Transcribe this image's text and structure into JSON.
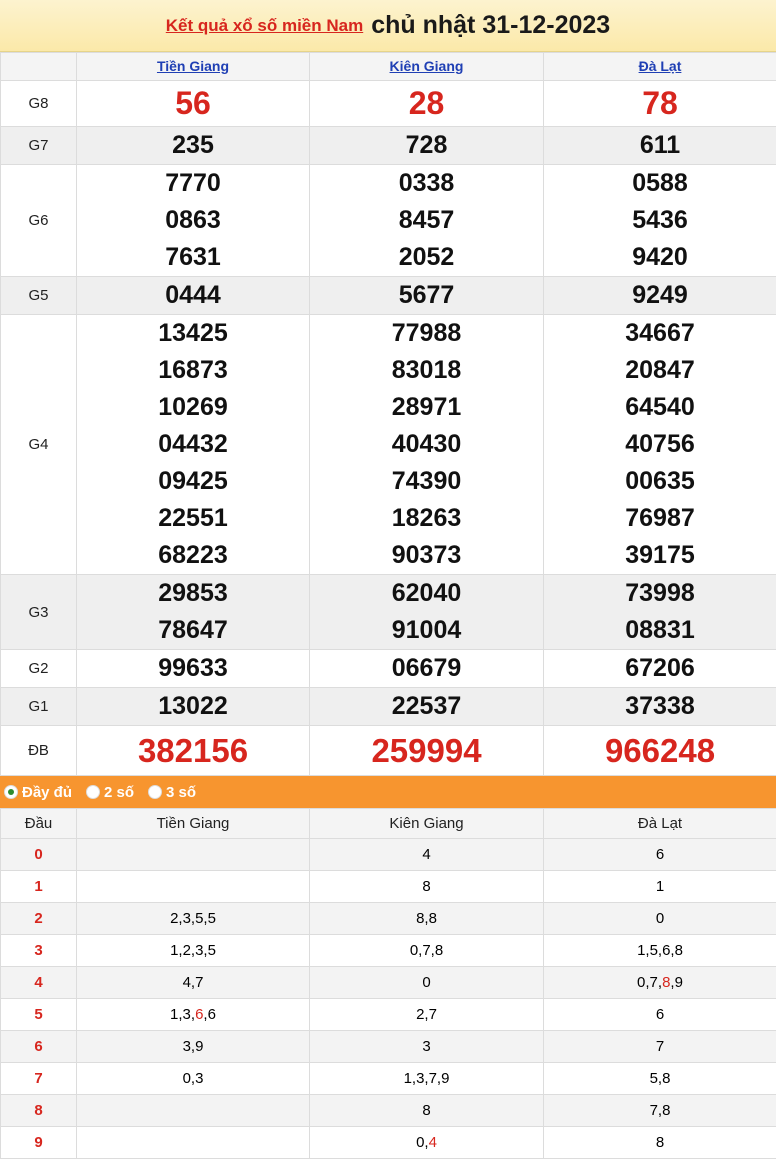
{
  "header": {
    "link_text": "Kết quả xổ số miền Nam",
    "date_text": "chủ nhật 31-12-2023"
  },
  "provinces": [
    "Tiền Giang",
    "Kiên Giang",
    "Đà Lạt"
  ],
  "prizes": [
    {
      "label": "G8",
      "values": [
        [
          "56"
        ],
        [
          "28"
        ],
        [
          "78"
        ]
      ]
    },
    {
      "label": "G7",
      "values": [
        [
          "235"
        ],
        [
          "728"
        ],
        [
          "611"
        ]
      ]
    },
    {
      "label": "G6",
      "values": [
        [
          "7770",
          "0863",
          "7631"
        ],
        [
          "0338",
          "8457",
          "2052"
        ],
        [
          "0588",
          "5436",
          "9420"
        ]
      ]
    },
    {
      "label": "G5",
      "values": [
        [
          "0444"
        ],
        [
          "5677"
        ],
        [
          "9249"
        ]
      ]
    },
    {
      "label": "G4",
      "values": [
        [
          "13425",
          "16873",
          "10269",
          "04432",
          "09425",
          "22551",
          "68223"
        ],
        [
          "77988",
          "83018",
          "28971",
          "40430",
          "74390",
          "18263",
          "90373"
        ],
        [
          "34667",
          "20847",
          "64540",
          "40756",
          "00635",
          "76987",
          "39175"
        ]
      ]
    },
    {
      "label": "G3",
      "values": [
        [
          "29853",
          "78647"
        ],
        [
          "62040",
          "91004"
        ],
        [
          "73998",
          "08831"
        ]
      ]
    },
    {
      "label": "G2",
      "values": [
        [
          "99633"
        ],
        [
          "06679"
        ],
        [
          "67206"
        ]
      ]
    },
    {
      "label": "G1",
      "values": [
        [
          "13022"
        ],
        [
          "22537"
        ],
        [
          "37338"
        ]
      ]
    },
    {
      "label": "ĐB",
      "values": [
        [
          "382156"
        ],
        [
          "259994"
        ],
        [
          "966248"
        ]
      ]
    }
  ],
  "options": {
    "full": "Đầy đủ",
    "two": "2 số",
    "three": "3 số",
    "selected": "full"
  },
  "dau_table": {
    "header": "Đầu",
    "rows": [
      {
        "dau": "0",
        "cells": [
          [],
          [
            {
              "t": "4"
            }
          ],
          [
            {
              "t": "6"
            }
          ]
        ]
      },
      {
        "dau": "1",
        "cells": [
          [],
          [
            {
              "t": "8"
            }
          ],
          [
            {
              "t": "1"
            }
          ]
        ]
      },
      {
        "dau": "2",
        "cells": [
          [
            {
              "t": "2,3,5,5"
            }
          ],
          [
            {
              "t": "8,8"
            }
          ],
          [
            {
              "t": "0"
            }
          ]
        ]
      },
      {
        "dau": "3",
        "cells": [
          [
            {
              "t": "1,2,3,5"
            }
          ],
          [
            {
              "t": "0,7,8"
            }
          ],
          [
            {
              "t": "1,5,6,8"
            }
          ]
        ]
      },
      {
        "dau": "4",
        "cells": [
          [
            {
              "t": "4,7"
            }
          ],
          [
            {
              "t": "0"
            }
          ],
          [
            {
              "t": "0,7,"
            },
            {
              "t": "8",
              "r": true
            },
            {
              "t": ",9"
            }
          ]
        ]
      },
      {
        "dau": "5",
        "cells": [
          [
            {
              "t": "1,3,"
            },
            {
              "t": "6",
              "r": true
            },
            {
              "t": ",6"
            }
          ],
          [
            {
              "t": "2,7"
            }
          ],
          [
            {
              "t": "6"
            }
          ]
        ]
      },
      {
        "dau": "6",
        "cells": [
          [
            {
              "t": "3,9"
            }
          ],
          [
            {
              "t": "3"
            }
          ],
          [
            {
              "t": "7"
            }
          ]
        ]
      },
      {
        "dau": "7",
        "cells": [
          [
            {
              "t": "0,3"
            }
          ],
          [
            {
              "t": "1,3,7,9"
            }
          ],
          [
            {
              "t": "5,8"
            }
          ]
        ]
      },
      {
        "dau": "8",
        "cells": [
          [],
          [
            {
              "t": "8"
            }
          ],
          [
            {
              "t": "7,8"
            }
          ]
        ]
      },
      {
        "dau": "9",
        "cells": [
          [],
          [
            {
              "t": "0,"
            },
            {
              "t": "4",
              "r": true
            }
          ],
          [
            {
              "t": "8"
            }
          ]
        ]
      }
    ]
  },
  "colors": {
    "accent_red": "#d7261e",
    "link_blue": "#1f3fb4",
    "option_bar": "#f7952f"
  }
}
